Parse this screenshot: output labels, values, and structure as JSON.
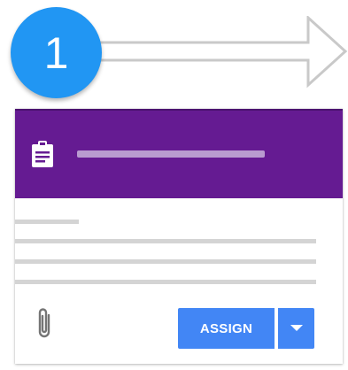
{
  "step": {
    "number": "1",
    "color": "#2196f3"
  },
  "arrow": {
    "icon": "arrow-right-outline-icon"
  },
  "card": {
    "header_color": "#651b92",
    "header_icon": "clipboard-icon",
    "attachment_icon": "paperclip-icon",
    "assign_label": "ASSIGN",
    "dropdown_icon": "chevron-down-icon",
    "button_color": "#4286f5"
  }
}
